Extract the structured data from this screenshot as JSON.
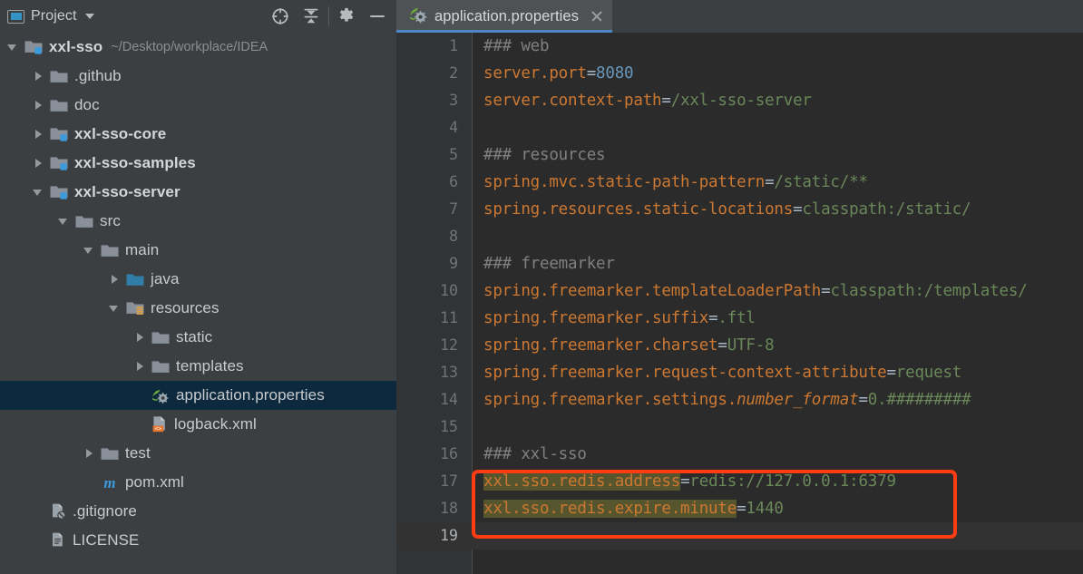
{
  "toolwindow": {
    "title": "Project",
    "title_icon": "project-window-icon",
    "dropdown_icon": "chevron-down-icon",
    "actions": [
      {
        "name": "select-opened-file-icon",
        "label": "Select Opened File"
      },
      {
        "name": "collapse-all-icon",
        "label": "Collapse All"
      },
      {
        "name": "gear-icon",
        "label": "Settings"
      },
      {
        "name": "minimize-icon",
        "label": "Hide"
      }
    ]
  },
  "tabs": [
    {
      "label": "application.properties",
      "icon": "spring-properties-icon",
      "close_icon": "close-icon",
      "active": true
    }
  ],
  "tree": [
    {
      "indent": 0,
      "twisty": "open",
      "icon": "module-folder-icon",
      "label": "xxl-sso",
      "bold": true,
      "path": "~/Desktop/workplace/IDEA",
      "selected": false
    },
    {
      "indent": 1,
      "twisty": "closed",
      "icon": "folder-icon",
      "label": ".github",
      "bold": false,
      "path": "",
      "selected": false
    },
    {
      "indent": 1,
      "twisty": "closed",
      "icon": "folder-icon",
      "label": "doc",
      "bold": false,
      "path": "",
      "selected": false
    },
    {
      "indent": 1,
      "twisty": "closed",
      "icon": "module-folder-icon",
      "label": "xxl-sso-core",
      "bold": true,
      "path": "",
      "selected": false
    },
    {
      "indent": 1,
      "twisty": "closed",
      "icon": "module-folder-icon",
      "label": "xxl-sso-samples",
      "bold": true,
      "path": "",
      "selected": false
    },
    {
      "indent": 1,
      "twisty": "open",
      "icon": "module-folder-icon",
      "label": "xxl-sso-server",
      "bold": true,
      "path": "",
      "selected": false
    },
    {
      "indent": 2,
      "twisty": "open",
      "icon": "folder-icon",
      "label": "src",
      "bold": false,
      "path": "",
      "selected": false
    },
    {
      "indent": 3,
      "twisty": "open",
      "icon": "folder-icon",
      "label": "main",
      "bold": false,
      "path": "",
      "selected": false
    },
    {
      "indent": 4,
      "twisty": "closed",
      "icon": "source-folder-icon",
      "label": "java",
      "bold": false,
      "path": "",
      "selected": false
    },
    {
      "indent": 4,
      "twisty": "open",
      "icon": "resource-folder-icon",
      "label": "resources",
      "bold": false,
      "path": "",
      "selected": false
    },
    {
      "indent": 5,
      "twisty": "closed",
      "icon": "folder-icon",
      "label": "static",
      "bold": false,
      "path": "",
      "selected": false
    },
    {
      "indent": 5,
      "twisty": "closed",
      "icon": "folder-icon",
      "label": "templates",
      "bold": false,
      "path": "",
      "selected": false
    },
    {
      "indent": 5,
      "twisty": "none",
      "icon": "spring-properties-icon",
      "label": "application.properties",
      "bold": false,
      "path": "",
      "selected": true
    },
    {
      "indent": 5,
      "twisty": "none",
      "icon": "xml-file-icon",
      "label": "logback.xml",
      "bold": false,
      "path": "",
      "selected": false
    },
    {
      "indent": 3,
      "twisty": "closed",
      "icon": "folder-icon",
      "label": "test",
      "bold": false,
      "path": "",
      "selected": false
    },
    {
      "indent": 3,
      "twisty": "none",
      "icon": "maven-icon",
      "label": "pom.xml",
      "bold": false,
      "path": "",
      "selected": false
    },
    {
      "indent": 1,
      "twisty": "none",
      "icon": "gitignore-file-icon",
      "label": ".gitignore",
      "bold": false,
      "path": "",
      "selected": false
    },
    {
      "indent": 1,
      "twisty": "none",
      "icon": "text-file-icon",
      "label": "LICENSE",
      "bold": false,
      "path": "",
      "selected": false
    }
  ],
  "editor": {
    "file": "application.properties",
    "current_line": 19,
    "lines": [
      {
        "n": "1",
        "tokens": [
          {
            "t": "### web",
            "c": "cmt"
          }
        ]
      },
      {
        "n": "2",
        "tokens": [
          {
            "t": "server.port",
            "c": "key"
          },
          {
            "t": "=",
            "c": "eq"
          },
          {
            "t": "8080",
            "c": "num-lit"
          }
        ]
      },
      {
        "n": "3",
        "tokens": [
          {
            "t": "server.context-path",
            "c": "key"
          },
          {
            "t": "=",
            "c": "eq"
          },
          {
            "t": "/xxl-sso-server",
            "c": "val"
          }
        ]
      },
      {
        "n": "4",
        "tokens": []
      },
      {
        "n": "5",
        "tokens": [
          {
            "t": "### resources",
            "c": "cmt"
          }
        ]
      },
      {
        "n": "6",
        "tokens": [
          {
            "t": "spring.mvc.static-path-pattern",
            "c": "key"
          },
          {
            "t": "=",
            "c": "eq"
          },
          {
            "t": "/static/**",
            "c": "val"
          }
        ]
      },
      {
        "n": "7",
        "tokens": [
          {
            "t": "spring.resources.static-locations",
            "c": "key"
          },
          {
            "t": "=",
            "c": "eq"
          },
          {
            "t": "classpath:/static/",
            "c": "val"
          }
        ]
      },
      {
        "n": "8",
        "tokens": []
      },
      {
        "n": "9",
        "tokens": [
          {
            "t": "### freemarker",
            "c": "cmt"
          }
        ]
      },
      {
        "n": "10",
        "tokens": [
          {
            "t": "spring.freemarker.templateLoaderPath",
            "c": "key"
          },
          {
            "t": "=",
            "c": "eq"
          },
          {
            "t": "classpath:/templates/",
            "c": "val"
          }
        ]
      },
      {
        "n": "11",
        "tokens": [
          {
            "t": "spring.freemarker.suffix",
            "c": "key"
          },
          {
            "t": "=",
            "c": "eq"
          },
          {
            "t": ".ftl",
            "c": "val"
          }
        ]
      },
      {
        "n": "12",
        "tokens": [
          {
            "t": "spring.freemarker.charset",
            "c": "key"
          },
          {
            "t": "=",
            "c": "eq"
          },
          {
            "t": "UTF-8",
            "c": "val"
          }
        ]
      },
      {
        "n": "13",
        "tokens": [
          {
            "t": "spring.freemarker.request-context-attribute",
            "c": "key"
          },
          {
            "t": "=",
            "c": "eq"
          },
          {
            "t": "request",
            "c": "val"
          }
        ]
      },
      {
        "n": "14",
        "tokens": [
          {
            "t": "spring.freemarker.settings.",
            "c": "key"
          },
          {
            "t": "number_format",
            "c": "key ital"
          },
          {
            "t": "=",
            "c": "eq"
          },
          {
            "t": "0.#########",
            "c": "val"
          }
        ]
      },
      {
        "n": "15",
        "tokens": []
      },
      {
        "n": "16",
        "tokens": [
          {
            "t": "### xxl-sso",
            "c": "cmt"
          }
        ]
      },
      {
        "n": "17",
        "tokens": [
          {
            "t": "xxl.sso.redis.address",
            "c": "key hl"
          },
          {
            "t": "=",
            "c": "eq"
          },
          {
            "t": "redis://127.0.0.1:6379",
            "c": "val"
          }
        ]
      },
      {
        "n": "18",
        "tokens": [
          {
            "t": "xxl.sso.redis.expire.minute",
            "c": "key hl"
          },
          {
            "t": "=",
            "c": "eq"
          },
          {
            "t": "1440",
            "c": "val"
          }
        ]
      },
      {
        "n": "19",
        "tokens": []
      }
    ],
    "annotation": {
      "name": "red-highlight-box",
      "color": "#FF3C12",
      "covers_lines": "17-18"
    }
  },
  "colors": {
    "background": "#3C3F41",
    "editor_background": "#2B2B2B",
    "selection": "#0D293E",
    "tab_active_underline": "#4A88C7",
    "comment": "#808080",
    "property_key": "#CC7832",
    "property_value": "#6A8759",
    "number": "#6897BB",
    "search_highlight": "#56552D",
    "annotation_red": "#FF3C12"
  }
}
